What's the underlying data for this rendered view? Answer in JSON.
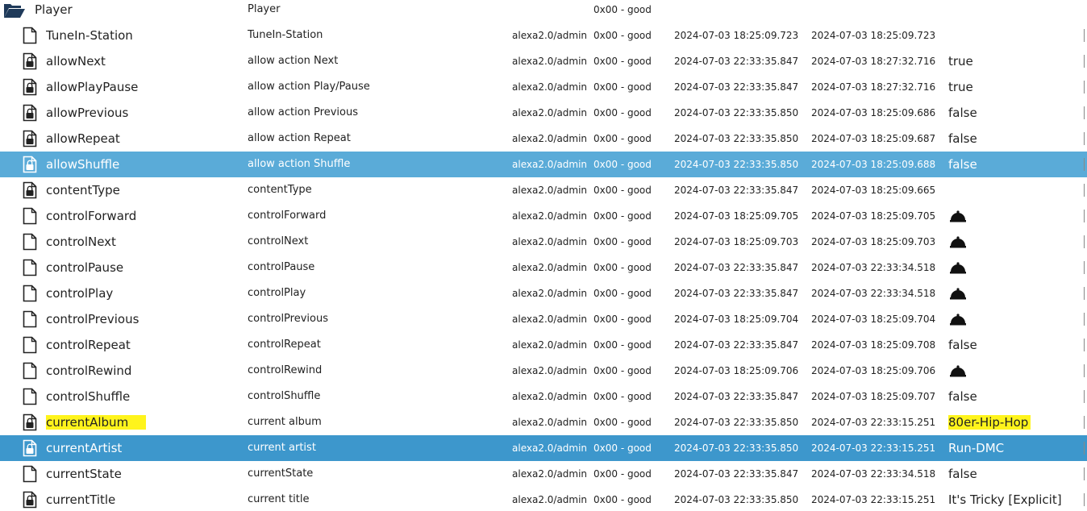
{
  "colors": {
    "selected_light": "#5aabd8",
    "selected_dark": "#3d97cc",
    "highlight": "#fff41c"
  },
  "folder": {
    "name": "Player",
    "desc": "Player",
    "quality": "0x00 - good",
    "icon": "folder-open-icon"
  },
  "rows": [
    {
      "name": "TuneIn-Station",
      "desc": "TuneIn-Station",
      "role": "alexa2.0/admin",
      "quality": "0x00 - good",
      "ts": "2024-07-03 18:25:09.723",
      "lc": "2024-07-03 18:25:09.723",
      "value": "",
      "icon": "file-icon"
    },
    {
      "name": "allowNext",
      "desc": "allow action Next",
      "role": "alexa2.0/admin",
      "quality": "0x00 - good",
      "ts": "2024-07-03 22:33:35.847",
      "lc": "2024-07-03 18:27:32.716",
      "value": "true",
      "icon": "file-lock-icon"
    },
    {
      "name": "allowPlayPause",
      "desc": "allow action Play/Pause",
      "role": "alexa2.0/admin",
      "quality": "0x00 - good",
      "ts": "2024-07-03 22:33:35.847",
      "lc": "2024-07-03 18:27:32.716",
      "value": "true",
      "icon": "file-lock-icon"
    },
    {
      "name": "allowPrevious",
      "desc": "allow action Previous",
      "role": "alexa2.0/admin",
      "quality": "0x00 - good",
      "ts": "2024-07-03 22:33:35.850",
      "lc": "2024-07-03 18:25:09.686",
      "value": "false",
      "icon": "file-lock-icon"
    },
    {
      "name": "allowRepeat",
      "desc": "allow action Repeat",
      "role": "alexa2.0/admin",
      "quality": "0x00 - good",
      "ts": "2024-07-03 22:33:35.850",
      "lc": "2024-07-03 18:25:09.687",
      "value": "false",
      "icon": "file-lock-icon"
    },
    {
      "name": "allowShuffle",
      "desc": "allow action Shuffle",
      "role": "alexa2.0/admin",
      "quality": "0x00 - good",
      "ts": "2024-07-03 22:33:35.850",
      "lc": "2024-07-03 18:25:09.688",
      "value": "false",
      "icon": "file-lock-icon",
      "state": "sel-light"
    },
    {
      "name": "contentType",
      "desc": "contentType",
      "role": "alexa2.0/admin",
      "quality": "0x00 - good",
      "ts": "2024-07-03 22:33:35.847",
      "lc": "2024-07-03 18:25:09.665",
      "value": "",
      "icon": "file-lock-icon"
    },
    {
      "name": "controlForward",
      "desc": "controlForward",
      "role": "alexa2.0/admin",
      "quality": "0x00 - good",
      "ts": "2024-07-03 18:25:09.705",
      "lc": "2024-07-03 18:25:09.705",
      "value": "",
      "icon": "file-icon",
      "bell": true
    },
    {
      "name": "controlNext",
      "desc": "controlNext",
      "role": "alexa2.0/admin",
      "quality": "0x00 - good",
      "ts": "2024-07-03 18:25:09.703",
      "lc": "2024-07-03 18:25:09.703",
      "value": "",
      "icon": "file-icon",
      "bell": true
    },
    {
      "name": "controlPause",
      "desc": "controlPause",
      "role": "alexa2.0/admin",
      "quality": "0x00 - good",
      "ts": "2024-07-03 22:33:35.847",
      "lc": "2024-07-03 22:33:34.518",
      "value": "",
      "icon": "file-icon",
      "bell": true
    },
    {
      "name": "controlPlay",
      "desc": "controlPlay",
      "role": "alexa2.0/admin",
      "quality": "0x00 - good",
      "ts": "2024-07-03 22:33:35.847",
      "lc": "2024-07-03 22:33:34.518",
      "value": "",
      "icon": "file-icon",
      "bell": true
    },
    {
      "name": "controlPrevious",
      "desc": "controlPrevious",
      "role": "alexa2.0/admin",
      "quality": "0x00 - good",
      "ts": "2024-07-03 18:25:09.704",
      "lc": "2024-07-03 18:25:09.704",
      "value": "",
      "icon": "file-icon",
      "bell": true
    },
    {
      "name": "controlRepeat",
      "desc": "controlRepeat",
      "role": "alexa2.0/admin",
      "quality": "0x00 - good",
      "ts": "2024-07-03 22:33:35.847",
      "lc": "2024-07-03 18:25:09.708",
      "value": "false",
      "icon": "file-icon"
    },
    {
      "name": "controlRewind",
      "desc": "controlRewind",
      "role": "alexa2.0/admin",
      "quality": "0x00 - good",
      "ts": "2024-07-03 18:25:09.706",
      "lc": "2024-07-03 18:25:09.706",
      "value": "",
      "icon": "file-icon",
      "bell": true
    },
    {
      "name": "controlShuffle",
      "desc": "controlShuffle",
      "role": "alexa2.0/admin",
      "quality": "0x00 - good",
      "ts": "2024-07-03 22:33:35.847",
      "lc": "2024-07-03 18:25:09.707",
      "value": "false",
      "icon": "file-icon"
    },
    {
      "name": "currentAlbum",
      "desc": "current album",
      "role": "alexa2.0/admin",
      "quality": "0x00 - good",
      "ts": "2024-07-03 22:33:35.850",
      "lc": "2024-07-03 22:33:15.251",
      "value": "80er-Hip-Hop",
      "icon": "file-lock-icon",
      "highlight": true
    },
    {
      "name": "currentArtist",
      "desc": "current artist",
      "role": "alexa2.0/admin",
      "quality": "0x00 - good",
      "ts": "2024-07-03 22:33:35.850",
      "lc": "2024-07-03 22:33:15.251",
      "value": "Run-DMC",
      "icon": "file-lock-icon",
      "state": "sel-dark"
    },
    {
      "name": "currentState",
      "desc": "currentState",
      "role": "alexa2.0/admin",
      "quality": "0x00 - good",
      "ts": "2024-07-03 22:33:35.847",
      "lc": "2024-07-03 22:33:34.518",
      "value": "false",
      "icon": "file-icon"
    },
    {
      "name": "currentTitle",
      "desc": "current title",
      "role": "alexa2.0/admin",
      "quality": "0x00 - good",
      "ts": "2024-07-03 22:33:35.850",
      "lc": "2024-07-03 22:33:15.251",
      "value": "It's Tricky [Explicit]",
      "icon": "file-lock-icon"
    }
  ]
}
